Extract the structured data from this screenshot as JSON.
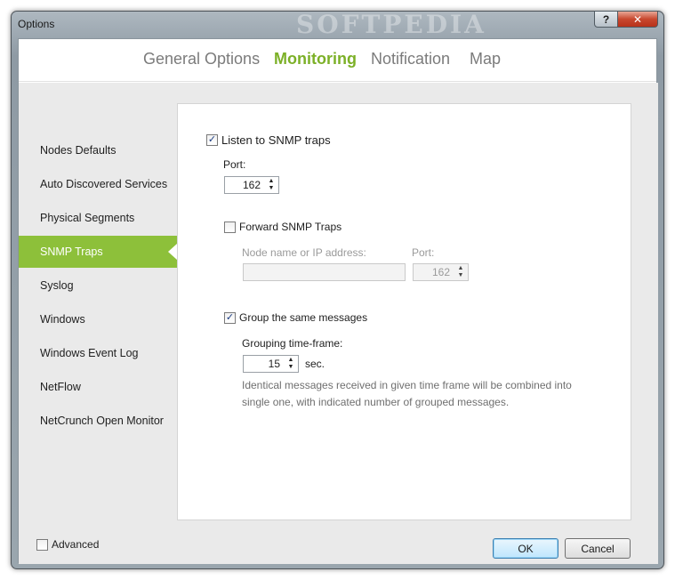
{
  "window": {
    "title": "Options",
    "watermark": "SOFTPEDIA",
    "help_glyph": "?",
    "close_glyph": "✕"
  },
  "top_tabs": [
    {
      "label": "General Options",
      "active": false
    },
    {
      "label": "Monitoring",
      "active": true
    },
    {
      "label": "Notification",
      "active": false
    },
    {
      "label": "Map",
      "active": false
    }
  ],
  "sidebar": {
    "items": [
      {
        "label": "Nodes Defaults",
        "active": false
      },
      {
        "label": "Auto Discovered Services",
        "active": false
      },
      {
        "label": "Physical Segments",
        "active": false
      },
      {
        "label": "SNMP Traps",
        "active": true
      },
      {
        "label": "Syslog",
        "active": false
      },
      {
        "label": "Windows",
        "active": false
      },
      {
        "label": "Windows Event Log",
        "active": false
      },
      {
        "label": "NetFlow",
        "active": false
      },
      {
        "label": "NetCrunch Open Monitor",
        "active": false
      }
    ],
    "accent_color": "#8dc03a"
  },
  "snmp": {
    "listen_label": "Listen to SNMP traps",
    "listen_checked": true,
    "port_label": "Port:",
    "port_value": "162",
    "forward_label": "Forward SNMP Traps",
    "forward_checked": false,
    "node_label": "Node name or IP address:",
    "node_value": "",
    "forward_port_label": "Port:",
    "forward_port_value": "162",
    "group_label": "Group the same messages",
    "group_checked": true,
    "timeframe_label": "Grouping time-frame:",
    "timeframe_value": "15",
    "timeframe_unit": "sec.",
    "note_line1": "Identical messages received in given time frame will be combined into",
    "note_line2": "single one, with indicated number of grouped messages."
  },
  "footer": {
    "advanced_label": "Advanced",
    "advanced_checked": false,
    "ok_label": "OK",
    "cancel_label": "Cancel"
  },
  "colors": {
    "active_tab": "#7cb027",
    "inactive_tab": "#7b7b7b"
  }
}
